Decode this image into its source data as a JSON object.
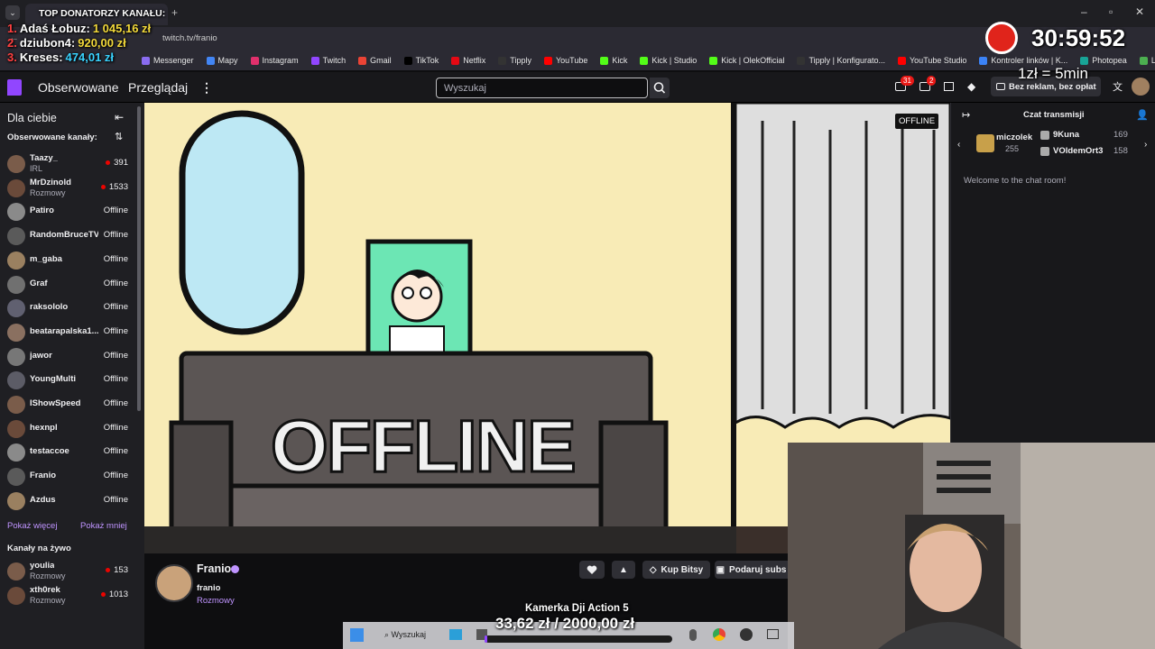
{
  "browser": {
    "url": "twitch.tv/franio",
    "bookmarks": [
      "Messenger",
      "Mapy",
      "Instagram",
      "Twitch",
      "Gmail",
      "TikTok",
      "Netflix",
      "Tipply",
      "YouTube",
      "Kick",
      "Kick | Studio",
      "Kick | OlekOfficial",
      "Tipply | Konfigurato...",
      "YouTube Studio",
      "Kontroler linków | K...",
      "Photopea",
      "Licznik Like"
    ],
    "bookmark_colors": [
      "#8a6cf0",
      "#4285f4",
      "#e1306c",
      "#9146ff",
      "#ea4335",
      "#000000",
      "#e50914",
      "#333333",
      "#ff0000",
      "#53fc18",
      "#53fc18",
      "#53fc18",
      "#333333",
      "#ff0000",
      "#3b82f6",
      "#18a497",
      "#4caf50"
    ]
  },
  "donors": {
    "title": "TOP DONATORZY KANAŁU:",
    "items": [
      {
        "rank": "1.",
        "name": "Adaś Łobuz:",
        "amount": "1 045,16 zł"
      },
      {
        "rank": "2.",
        "name": "dziubon4:",
        "amount": "920,00 zł"
      },
      {
        "rank": "3.",
        "name": "Kreses:",
        "amount": "474,01 zł"
      }
    ]
  },
  "timer": {
    "value": "30:59:52",
    "rate": "1zł = 5min"
  },
  "nav": {
    "following": "Obserwowane",
    "browse": "Przeglądaj",
    "search_placeholder": "Wyszukaj",
    "notif_count": "31",
    "inbox_count": "2",
    "ad_free": "Bez reklam, bez opłat"
  },
  "sidebar": {
    "for_you": "Dla ciebie",
    "followed_header": "Obserwowane kanały:",
    "followed": [
      {
        "name": "Taazy_",
        "cat": "IRL",
        "stat": "391",
        "live": true
      },
      {
        "name": "MrDzinold",
        "cat": "Rozmowy",
        "stat": "1533",
        "live": true
      },
      {
        "name": "Patiro",
        "cat": "",
        "stat": "Offline",
        "live": false
      },
      {
        "name": "RandomBruceTV",
        "cat": "",
        "stat": "Offline",
        "live": false
      },
      {
        "name": "m_gaba",
        "cat": "",
        "stat": "Offline",
        "live": false
      },
      {
        "name": "Graf",
        "cat": "",
        "stat": "Offline",
        "live": false
      },
      {
        "name": "raksololo",
        "cat": "",
        "stat": "Offline",
        "live": false
      },
      {
        "name": "beatarapalska1...",
        "cat": "",
        "stat": "Offline",
        "live": false
      },
      {
        "name": "jawor",
        "cat": "",
        "stat": "Offline",
        "live": false
      },
      {
        "name": "YoungMulti",
        "cat": "",
        "stat": "Offline",
        "live": false
      },
      {
        "name": "IShowSpeed",
        "cat": "",
        "stat": "Offline",
        "live": false
      },
      {
        "name": "hexnpl",
        "cat": "",
        "stat": "Offline",
        "live": false
      },
      {
        "name": "testaccoe",
        "cat": "",
        "stat": "Offline",
        "live": false
      },
      {
        "name": "Franio",
        "cat": "",
        "stat": "Offline",
        "live": false
      },
      {
        "name": "Azdus",
        "cat": "",
        "stat": "Offline",
        "live": false
      }
    ],
    "show_more": "Pokaż więcej",
    "show_less": "Pokaż mniej",
    "live_header": "Kanały na żywo",
    "live": [
      {
        "name": "youlia",
        "cat": "Rozmowy",
        "stat": "153",
        "live": true
      },
      {
        "name": "xth0rek",
        "cat": "Rozmowy",
        "stat": "1013",
        "live": true
      }
    ]
  },
  "player": {
    "offline_badge": "OFFLINE",
    "offline_text": "OFFLINE"
  },
  "channel": {
    "name": "Franio",
    "login": "franio",
    "category": "Rozmowy",
    "buy_bits": "Kup Bitsy",
    "gift_subs": "Podaruj subs"
  },
  "goal": {
    "title": "Kamerka Dji Action 5",
    "current": "33,62 zł",
    "target": "2000,00 zł",
    "progress": 0.0168
  },
  "chat": {
    "title": "Czat transmisji",
    "welcome": "Welcome to the chat room!",
    "gifter": {
      "name": "miczolek",
      "count": "255"
    },
    "leaders": [
      {
        "name": "9Kuna",
        "count": "169"
      },
      {
        "name": "VOldemOrt3",
        "count": "158"
      }
    ]
  },
  "taskbar": {
    "search": "Wyszukaj"
  }
}
